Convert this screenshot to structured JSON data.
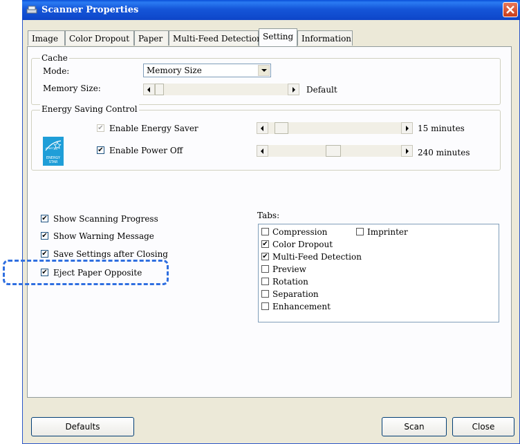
{
  "window": {
    "title": "Scanner Properties"
  },
  "tabs": [
    {
      "label": "Image"
    },
    {
      "label": "Color Dropout"
    },
    {
      "label": "Paper"
    },
    {
      "label": "Multi-Feed Detection"
    },
    {
      "label": "Setting"
    },
    {
      "label": "Information"
    }
  ],
  "active_tab": "Setting",
  "cache": {
    "group_label": "Cache",
    "mode_label": "Mode:",
    "mode_value": "Memory Size",
    "memory_size_label": "Memory Size:",
    "memory_size_value": "Default",
    "memory_size_level": 0.0
  },
  "energy": {
    "group_label": "Energy Saving Control",
    "logo_text": "ENERGY STAR",
    "enable_saver_label": "Enable Energy Saver",
    "enable_saver_checked": true,
    "enable_saver_disabled": true,
    "saver_value": "15 minutes",
    "saver_level": 0.0,
    "enable_poweroff_label": "Enable Power Off",
    "enable_poweroff_checked": true,
    "poweroff_value": "240 minutes",
    "poweroff_level": 0.48
  },
  "options": [
    {
      "label": "Show Scanning Progress",
      "checked": true
    },
    {
      "label": "Show Warning Message",
      "checked": true
    },
    {
      "label": "Save Settings after Closing",
      "checked": true
    },
    {
      "label": "Eject Paper Opposite",
      "checked": true
    }
  ],
  "tabs_list": {
    "label": "Tabs:",
    "items": [
      {
        "label": "Compression",
        "checked": false
      },
      {
        "label": "Imprinter",
        "checked": false
      },
      {
        "label": "Color Dropout",
        "checked": true
      },
      {
        "label": "Multi-Feed Detection",
        "checked": true
      },
      {
        "label": "Preview",
        "checked": false
      },
      {
        "label": "Rotation",
        "checked": false
      },
      {
        "label": "Separation",
        "checked": false
      },
      {
        "label": "Enhancement",
        "checked": false
      }
    ]
  },
  "buttons": {
    "defaults": "Defaults",
    "scan": "Scan",
    "close": "Close"
  },
  "colors": {
    "titlebar": "#0d45c8",
    "highlight": "#2f6fe0",
    "check": "#21a121"
  }
}
